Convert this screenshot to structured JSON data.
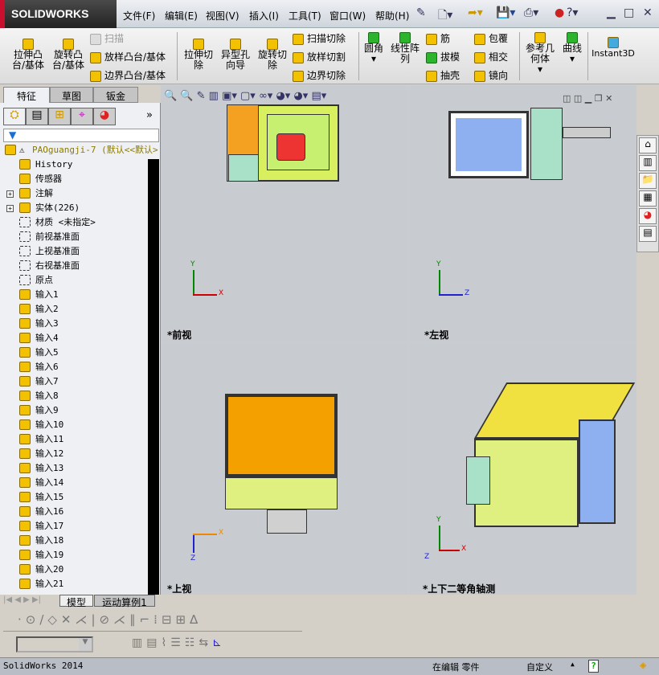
{
  "app": {
    "logo": "SOLIDWORKS"
  },
  "menu": [
    "文件(F)",
    "编辑(E)",
    "视图(V)",
    "插入(I)",
    "工具(T)",
    "窗口(W)",
    "帮助(H)"
  ],
  "commands": {
    "extrude_boss": "拉伸凸台/基体",
    "revolve_boss": "旋转凸台/基体",
    "sweep": "扫描",
    "loft": "放样凸台/基体",
    "boundary": "边界凸台/基体",
    "extrude_cut": "拉伸切除",
    "hole_wizard": "异型孔向导",
    "revolve_cut": "旋转切除",
    "sweep_cut": "扫描切除",
    "loft_cut": "放样切割",
    "boundary_cut": "边界切除",
    "fillet": "圆角",
    "linear_pattern": "线性阵列",
    "rib": "筋",
    "draft": "拔模",
    "shell": "抽壳",
    "wrap": "包覆",
    "intersect": "相交",
    "mirror": "镜向",
    "ref_geometry": "参考几何体",
    "curves": "曲线",
    "instant3d": "Instant3D"
  },
  "tabs": [
    "特征",
    "草图",
    "钣金"
  ],
  "tree": {
    "root": "PAOguangji-7",
    "config": "(默认<<默认>",
    "items": [
      {
        "label": "History",
        "expand": false
      },
      {
        "label": "传感器",
        "expand": false
      },
      {
        "label": "注解",
        "expand": true
      },
      {
        "label": "实体(226)",
        "expand": true
      },
      {
        "label": "材质 <未指定>",
        "expand": false
      },
      {
        "label": "前视基准面",
        "expand": false
      },
      {
        "label": "上视基准面",
        "expand": false
      },
      {
        "label": "右视基准面",
        "expand": false
      },
      {
        "label": "原点",
        "expand": false
      },
      {
        "label": "输入1"
      },
      {
        "label": "输入2"
      },
      {
        "label": "输入3"
      },
      {
        "label": "输入4"
      },
      {
        "label": "输入5"
      },
      {
        "label": "输入6"
      },
      {
        "label": "输入7"
      },
      {
        "label": "输入8"
      },
      {
        "label": "输入9"
      },
      {
        "label": "输入10"
      },
      {
        "label": "输入11"
      },
      {
        "label": "输入12"
      },
      {
        "label": "输入13"
      },
      {
        "label": "输入14"
      },
      {
        "label": "输入15"
      },
      {
        "label": "输入16"
      },
      {
        "label": "输入17"
      },
      {
        "label": "输入18"
      },
      {
        "label": "输入19"
      },
      {
        "label": "输入20"
      },
      {
        "label": "输入21"
      }
    ]
  },
  "viewports": {
    "front": "*前视",
    "left": "*左视",
    "top": "*上视",
    "iso": "*上下二等角轴测"
  },
  "axes": {
    "x": "X",
    "y": "Y",
    "z": "Z"
  },
  "bottom_tabs": [
    "模型",
    "运动算例1"
  ],
  "status": {
    "app": "SolidWorks 2014",
    "mode": "在编辑 零件",
    "units": "自定义"
  }
}
